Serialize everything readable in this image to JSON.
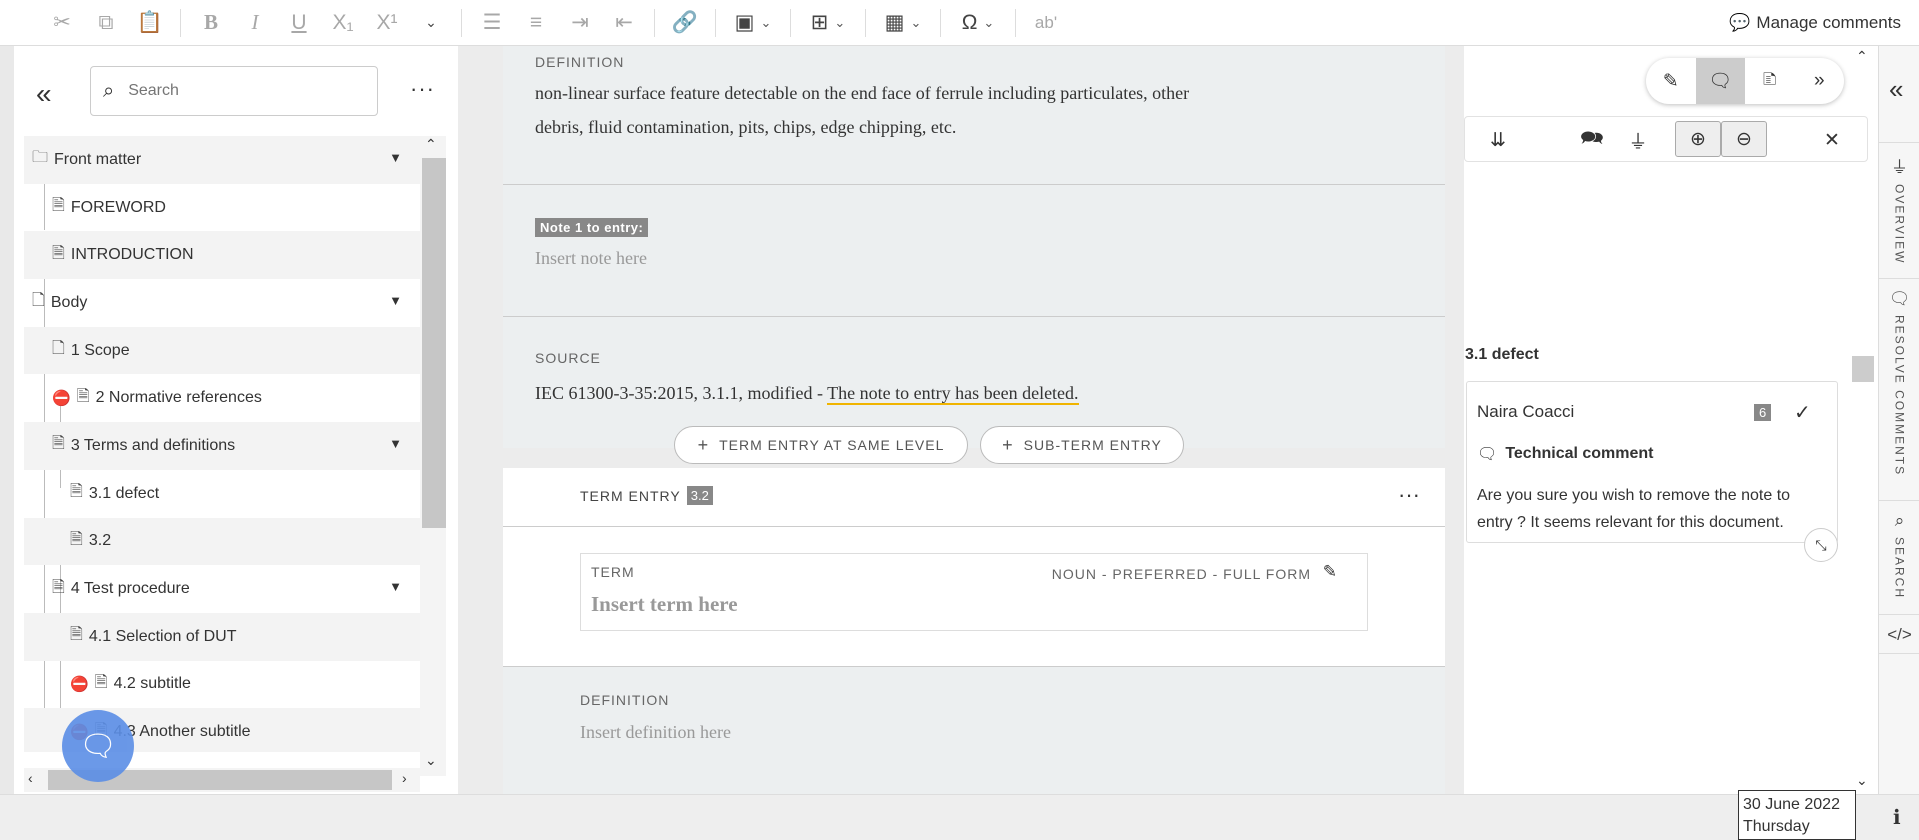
{
  "toolbar": {
    "manage_comments": "Manage comments",
    "special_char": "Ω",
    "superscript": "X¹",
    "subscript": "X₁",
    "spell": "ab'"
  },
  "tree": {
    "search_placeholder": "Search",
    "items": [
      {
        "label": "Front matter"
      },
      {
        "label": "FOREWORD"
      },
      {
        "label": "INTRODUCTION"
      },
      {
        "label": "Body"
      },
      {
        "label": "1 Scope"
      },
      {
        "label": "2 Normative references"
      },
      {
        "label": "3 Terms and definitions"
      },
      {
        "label": "3.1 defect"
      },
      {
        "label": "3.2"
      },
      {
        "label": "4 Test procedure"
      },
      {
        "label": "4.1 Selection of DUT"
      },
      {
        "label": "4.2 subtitle"
      },
      {
        "label": "4.3 Another subtitle"
      }
    ]
  },
  "editor": {
    "definition_label": "DEFINITION",
    "definition_line1": "non-linear surface feature detectable on the end face of ferrule including particulates, other",
    "definition_line2": "debris, fluid contamination, pits, chips, edge chipping, etc.",
    "note_badge": "Note 1 to entry:",
    "note_placeholder": "Insert note here",
    "source_label": "SOURCE",
    "source_prefix": "IEC 61300-3-35:2015, 3.1.1, modified - ",
    "source_deleted": "The note to entry has been deleted.",
    "add_same_level": "TERM ENTRY AT SAME LEVEL",
    "add_sub_term": "SUB-TERM ENTRY",
    "entry_label": "TERM ENTRY",
    "entry_number": "3.2",
    "term_label": "TERM",
    "term_meta": "NOUN - PREFERRED - FULL FORM",
    "term_placeholder": "Insert term here",
    "definition2_label": "DEFINITION",
    "definition2_placeholder": "Insert definition here"
  },
  "comments": {
    "group_title": "3.1 defect",
    "author": "Naira Coacci",
    "count": "6",
    "type": "Technical comment",
    "body": "Are you sure you wish to remove the note to entry ? It seems relevant for this document."
  },
  "rail": {
    "overview": "OVERVIEW",
    "resolve": "RESOLVE COMMENTS",
    "search": "SEARCH"
  },
  "status": {
    "date": "30 June 2022",
    "weekday": "Thursday"
  }
}
